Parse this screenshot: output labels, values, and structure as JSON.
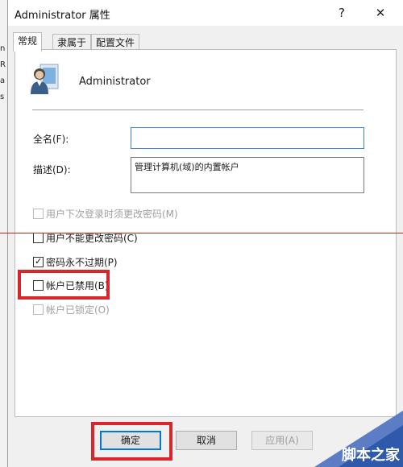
{
  "window": {
    "title": "Administrator 属性",
    "help_glyph": "?",
    "close_glyph": "✕"
  },
  "tabs": [
    {
      "label": "常规"
    },
    {
      "label": "隶属于"
    },
    {
      "label": "配置文件"
    }
  ],
  "user": {
    "name": "Administrator"
  },
  "fields": {
    "full_name_label": "全名(F):",
    "full_name_value": "",
    "description_label": "描述(D):",
    "description_value": "管理计算机(域)的内置帐户"
  },
  "checkboxes": [
    {
      "label": "用户下次登录时须更改密码(M)",
      "checked": false,
      "disabled": true
    },
    {
      "label": "用户不能更改密码(C)",
      "checked": false,
      "disabled": false
    },
    {
      "label": "密码永不过期(P)",
      "checked": true,
      "disabled": false
    },
    {
      "label": "帐户已禁用(B)",
      "checked": false,
      "disabled": false
    },
    {
      "label": "帐户已锁定(O)",
      "checked": false,
      "disabled": true
    }
  ],
  "buttons": {
    "ok": "确定",
    "cancel": "取消",
    "apply": "应用(A)"
  },
  "watermark": {
    "text": "脚本之家"
  },
  "colors": {
    "highlight_red": "#d9262c",
    "focus_blue": "#0078d7"
  }
}
